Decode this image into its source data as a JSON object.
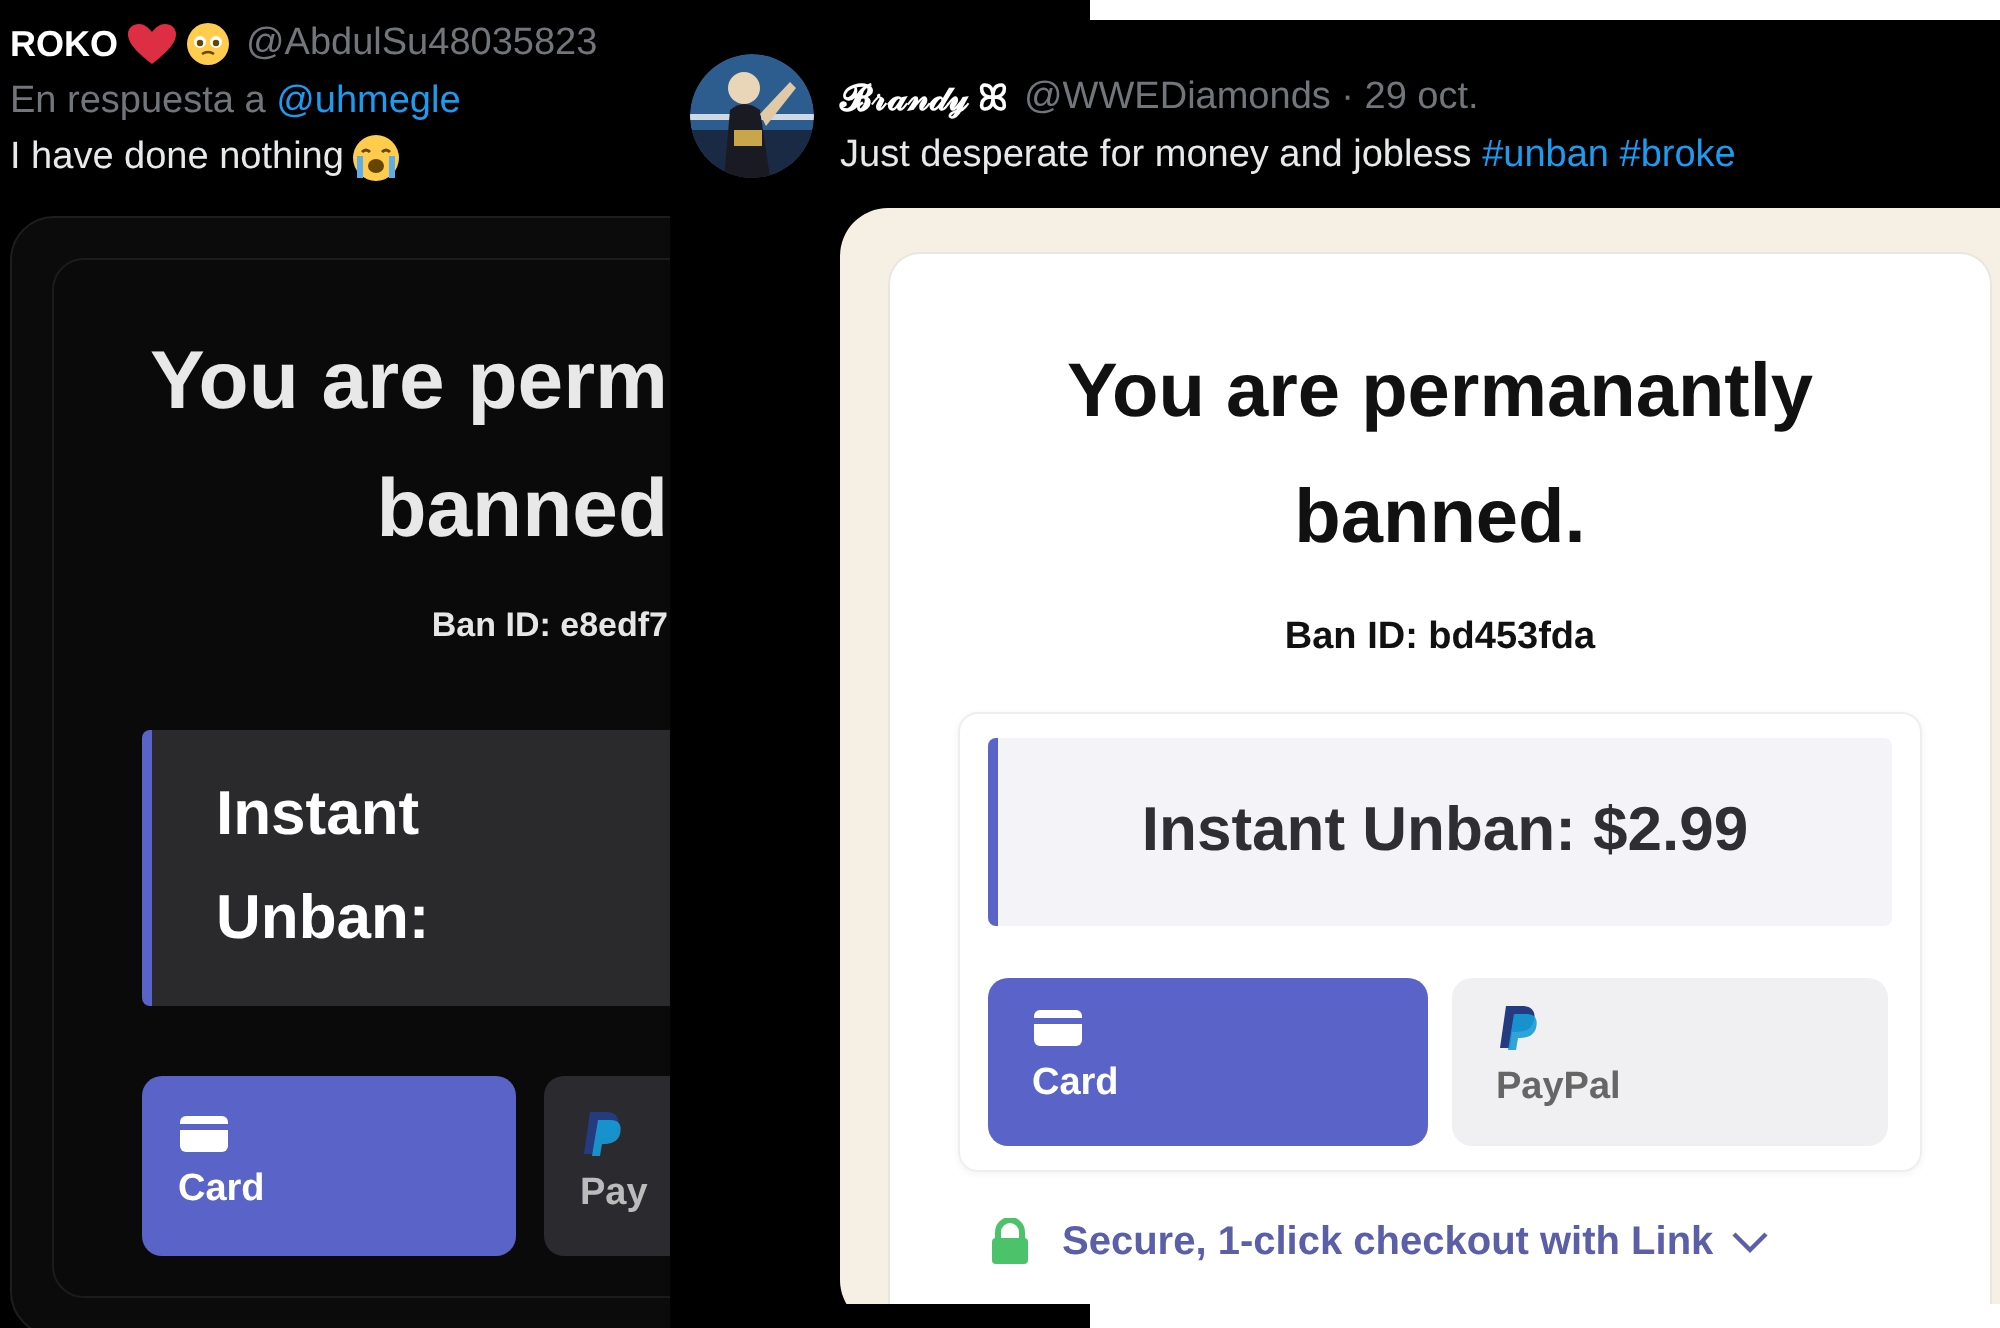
{
  "tweets": [
    {
      "display_name": "ROKO",
      "badges": [
        {
          "kind": "heart"
        },
        {
          "kind": "pleading"
        }
      ],
      "handle": "@AbdulSu48035823",
      "reply_prefix": "En respuesta a",
      "reply_to": "@uhmegle",
      "text": "I have done nothing",
      "text_emoji": {
        "kind": "crying"
      },
      "page": {
        "kind": "dark",
        "title_lines": [
          "You are perm",
          "banned"
        ],
        "ban_id": "Ban ID: e8edf7",
        "price_lines": [
          "Instant",
          "Unban:"
        ],
        "methods": [
          {
            "kind": "card",
            "label": "Card",
            "selected": true
          },
          {
            "kind": "paypal",
            "label": "Pay",
            "selected": false
          }
        ]
      }
    },
    {
      "display_name": "𝓑𝓇𝒶𝓃𝒹𝓎 ꕤ",
      "handle": "@WWEDiamonds · 29 oct.",
      "text": "Just desperate for money and jobless",
      "hashtags": [
        "#unban",
        "#broke"
      ],
      "page": {
        "kind": "light",
        "title_lines": [
          "You are permanantly",
          "banned."
        ],
        "ban_id": "Ban ID: bd453fda",
        "price_lines": [
          "Instant Unban: $2.99"
        ],
        "methods": [
          {
            "kind": "card",
            "label": "Card",
            "selected": true
          },
          {
            "kind": "paypal",
            "label": "PayPal",
            "selected": false
          }
        ],
        "secure_link": "Secure, 1-click checkout with Link"
      }
    }
  ]
}
